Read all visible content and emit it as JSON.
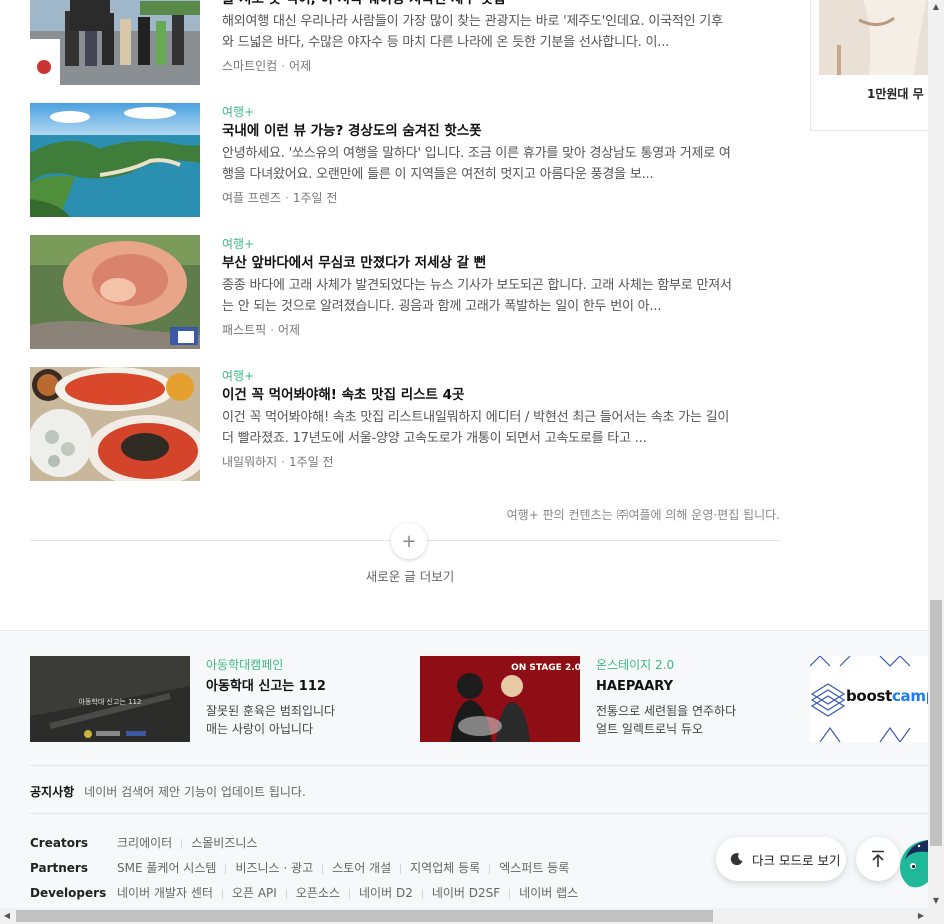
{
  "articles": [
    {
      "category": "",
      "title": "줄 서도 못 먹어, 이 시국 웨이팅 지옥인 제주 맛집",
      "desc": "해외여행 대신 우리나라 사람들이 가장 많이 찾는 관광지는 바로 '제주도'인데요. 이국적인 기후와 드넓은 바다, 수많은 야자수 등 마치 다른 나라에 온 듯한 기분을 선사합니다. 이...",
      "source": "스마트인컴",
      "time": "어제"
    },
    {
      "category": "여행+",
      "title": "국내에 이런 뷰 가능? 경상도의 숨겨진 핫스폿",
      "desc": "안녕하세요. '쏘스유의 여행을 말하다' 입니다. 조금 이른 휴가를 맞아 경상남도 통영과 거제로 여행을 다녀왔어요. 오랜만에 들른 이 지역들은 여전히 멋지고 아름다운 풍경을 보...",
      "source": "여플 프렌즈",
      "time": "1주일 전"
    },
    {
      "category": "여행+",
      "title": "부산 앞바다에서 무심코 만졌다가 저세상 갈 뻔",
      "desc": "종종 바다에 고래 사체가 발견되었다는 뉴스 기사가 보도되곤 합니다. 고래 사체는 함부로 만져서는 안 되는 것으로 알려졌습니다. 굉음과 함께 고래가 폭발하는 일이 한두 번이 아...",
      "source": "패스트픽",
      "time": "어제"
    },
    {
      "category": "여행+",
      "title": "이건 꼭 먹어봐야해! 속초 맛집 리스트 4곳",
      "desc": "이건 꼭 먹어봐야해! 속초 맛집 리스트내일뭐하지 에디터 / 박현선 최근 들어서는 속초 가는 길이 더 빨라졌죠. 17년도에 서울-양양 고속도로가 개통이 되면서 고속도로를 타고 ...",
      "source": "내일뭐하지",
      "time": "1주일 전"
    }
  ],
  "operated_note": "여행+ 판의 컨텐츠는 ㈜여플에 의해 운영·편집 됩니다.",
  "more_label": "새로운 글 더보기",
  "side_ad": {
    "caption": "1만원대 무"
  },
  "promos": [
    {
      "tag": "아동학대캠페인",
      "title": "아동학대 신고는 112",
      "desc1": "잘못된 훈육은 범죄입니다",
      "desc2": "매는 사랑이 아닙니다",
      "image_text": "아동학대 신고는 112"
    },
    {
      "tag": "온스테이지 2.0",
      "title": "HAEPAARY",
      "desc1": "전통으로 세련됨을 연주하다",
      "desc2": "얼트 일렉트로닉 듀오",
      "image_text": "ON STAGE 2.0"
    }
  ],
  "boost": {
    "brand_a": "boost",
    "brand_b": "camp"
  },
  "notice": {
    "label": "공지사항",
    "text": "네이버 검색어 제안 기능이 업데이트 됩니다."
  },
  "footer_rows": [
    {
      "label": "Creators",
      "links": [
        "크리에이터",
        "스몰비즈니스"
      ]
    },
    {
      "label": "Partners",
      "links": [
        "SME 풀케어 시스템",
        "비즈니스 · 광고",
        "스토어 개설",
        "지역업체 등록",
        "엑스퍼트 등록"
      ]
    },
    {
      "label": "Developers",
      "links": [
        "네이버 개발자 센터",
        "오픈 API",
        "오픈소스",
        "네이버 D2",
        "네이버 D2SF",
        "네이버 랩스"
      ]
    }
  ],
  "dark_mode_label": "다크 모드로 보기",
  "colors": {
    "accent_green": "#3fb984",
    "link_gray": "#666666"
  }
}
